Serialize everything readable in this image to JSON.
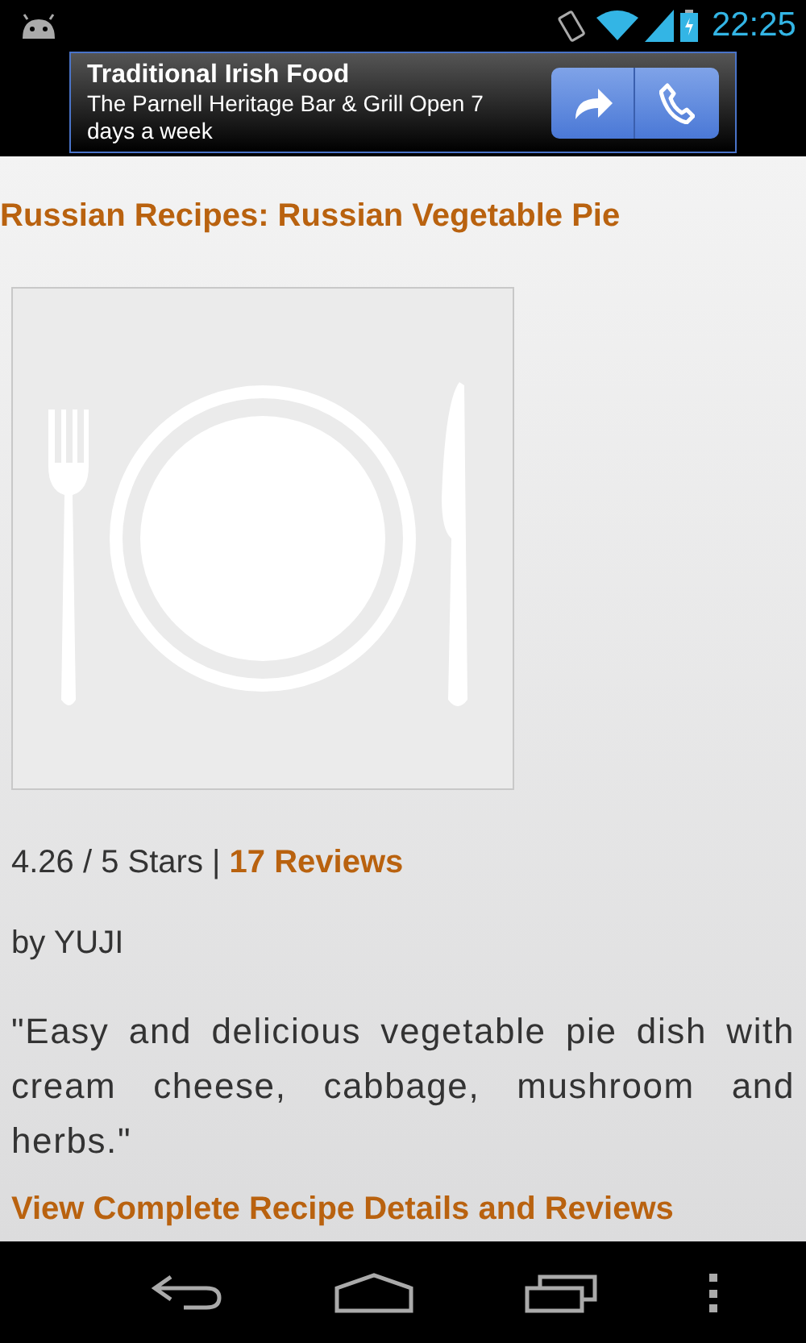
{
  "status_bar": {
    "time": "22:25"
  },
  "ad": {
    "title": "Traditional Irish Food",
    "text": "The Parnell Heritage Bar & Grill Open 7 days a week"
  },
  "recipe": {
    "title": "Russian Recipes: Russian Vegetable Pie",
    "rating": "4.26 / 5 Stars |",
    "reviews": "17 Reviews",
    "author": "by YUJI",
    "description": "\"Easy and delicious vegetable pie dish with cream cheese, cabbage, mushroom and herbs.\"",
    "details_link": "View Complete Recipe Details and Reviews"
  }
}
